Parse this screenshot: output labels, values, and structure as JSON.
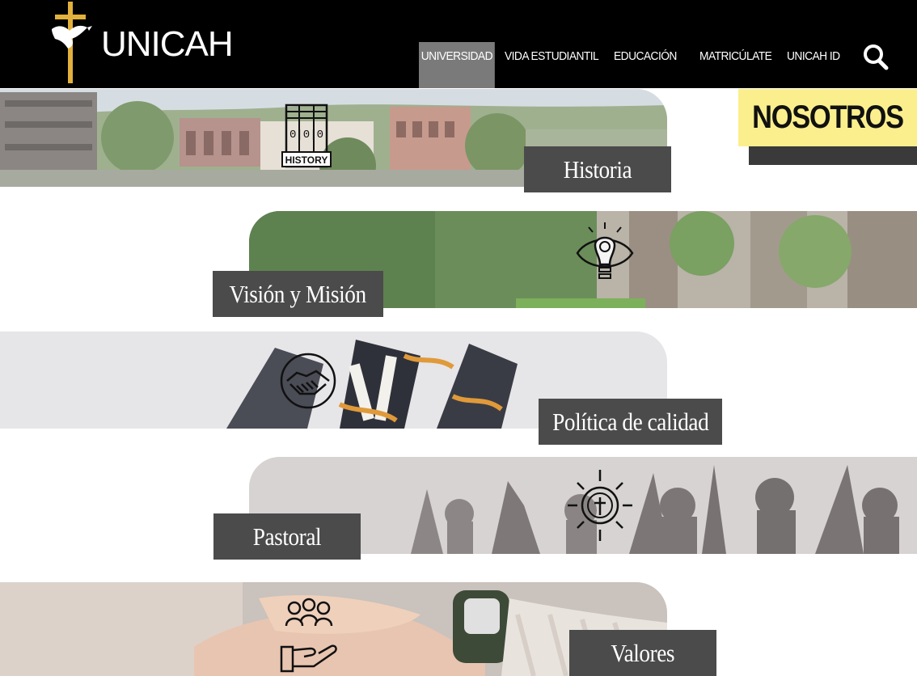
{
  "brand": {
    "name": "UNICAH"
  },
  "nav": {
    "items": [
      {
        "label": "UNIVERSIDAD",
        "active": true
      },
      {
        "label": "VIDA ESTUDIANTIL"
      },
      {
        "label": "EDUCACIÓN"
      },
      {
        "label": "MATRICÚLATE"
      },
      {
        "label": "UNICAH ID"
      }
    ],
    "search_icon": "search-icon"
  },
  "page": {
    "title": "NOSOTROS"
  },
  "sections": [
    {
      "label": "Historia",
      "icon": "history-icon"
    },
    {
      "label": "Visión y Misión",
      "icon": "lightbulb-eye-icon"
    },
    {
      "label": "Política de calidad",
      "icon": "handshake-icon"
    },
    {
      "label": "Pastoral",
      "icon": "cross-sun-icon"
    },
    {
      "label": "Valores",
      "icon": "people-hand-icon"
    }
  ],
  "colors": {
    "header_bg": "#000000",
    "active_nav": "#7a7a7a",
    "title_badge": "#fbef8d",
    "label_bg": "#4b4b4b"
  }
}
